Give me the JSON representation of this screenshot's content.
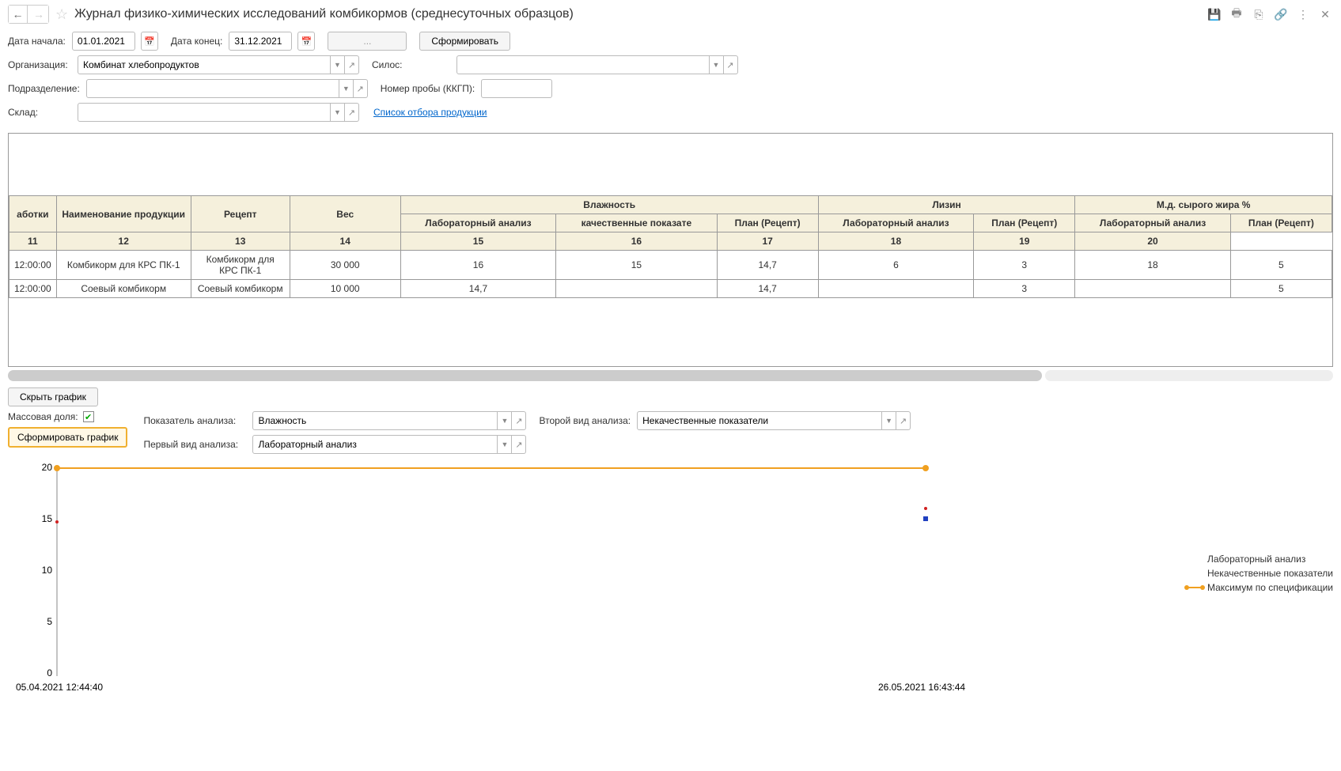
{
  "title": "Журнал физико-химических исследований комбикормов (среднесуточных образцов)",
  "filters": {
    "date_start_label": "Дата начала:",
    "date_start": "01.01.2021",
    "date_end_label": "Дата конец:",
    "date_end": "31.12.2021",
    "dots": "...",
    "form_btn": "Сформировать",
    "org_label": "Организация:",
    "org_value": "Комбинат хлебопродуктов",
    "silos_label": "Силос:",
    "div_label": "Подразделение:",
    "probe_label": "Номер пробы (ККГП):",
    "warehouse_label": "Склад:",
    "list_link": "Список отбора продукции"
  },
  "toggle_btn": "Скрыть график",
  "chart_ctrl": {
    "mass_label": "Массовая доля:",
    "form_btn": "Сформировать график",
    "indicator_label": "Показатель анализа:",
    "indicator_value": "Влажность",
    "first_label": "Первый вид анализа:",
    "first_value": "Лабораторный анализ",
    "second_label": "Второй вид анализа:",
    "second_value": "Некачественные показатели"
  },
  "table": {
    "h_abotki": "аботки",
    "h_name": "Наименование продукции",
    "h_recipe": "Рецепт",
    "h_weight": "Вес",
    "h_humidity": "Влажность",
    "h_lysine": "Лизин",
    "h_fat": "М.д. сырого жира %",
    "h_lab": "Лабораторный анализ",
    "h_qual": "качественные показате",
    "h_plan": "План (Рецепт)",
    "n11": "11",
    "n12": "12",
    "n13": "13",
    "n14": "14",
    "n15": "15",
    "n16": "16",
    "n17": "17",
    "n18": "18",
    "n19": "19",
    "n20": "20",
    "rows": [
      {
        "time": "12:00:00",
        "name": "Комбикорм для КРС ПК-1",
        "recipe": "Комбикорм для КРС ПК-1",
        "weight": "30 000",
        "h_lab": "16",
        "h_qual": "15",
        "h_plan": "14,7",
        "l_lab": "6",
        "l_plan": "3",
        "f_lab": "18",
        "f_plan": "5"
      },
      {
        "time": "12:00:00",
        "name": "Соевый комбикорм",
        "recipe": "Соевый комбикорм",
        "weight": "10 000",
        "h_lab": "14,7",
        "h_qual": "",
        "h_plan": "14,7",
        "l_lab": "",
        "l_plan": "3",
        "f_lab": "",
        "f_plan": "5"
      }
    ]
  },
  "chart_data": {
    "type": "line",
    "title": "",
    "ylim": [
      0,
      20
    ],
    "yticks": [
      0,
      5,
      10,
      15,
      20
    ],
    "x_categories": [
      "05.04.2021 12:44:40",
      "26.05.2021 16:43:44"
    ],
    "series": [
      {
        "name": "Лабораторный анализ",
        "color": "#d02020",
        "values": [
          14.7,
          16
        ],
        "marker": "dot"
      },
      {
        "name": "Некачественные показатели",
        "color": "#2040c0",
        "values": [
          null,
          15
        ],
        "marker": "square"
      },
      {
        "name": "Максимум по спецификации",
        "color": "#f0a020",
        "values": [
          20,
          20
        ],
        "line": true
      }
    ],
    "legend": {
      "lab": "Лабораторный анализ",
      "qual": "Некачественные показатели",
      "max": "Максимум по спецификации"
    }
  }
}
